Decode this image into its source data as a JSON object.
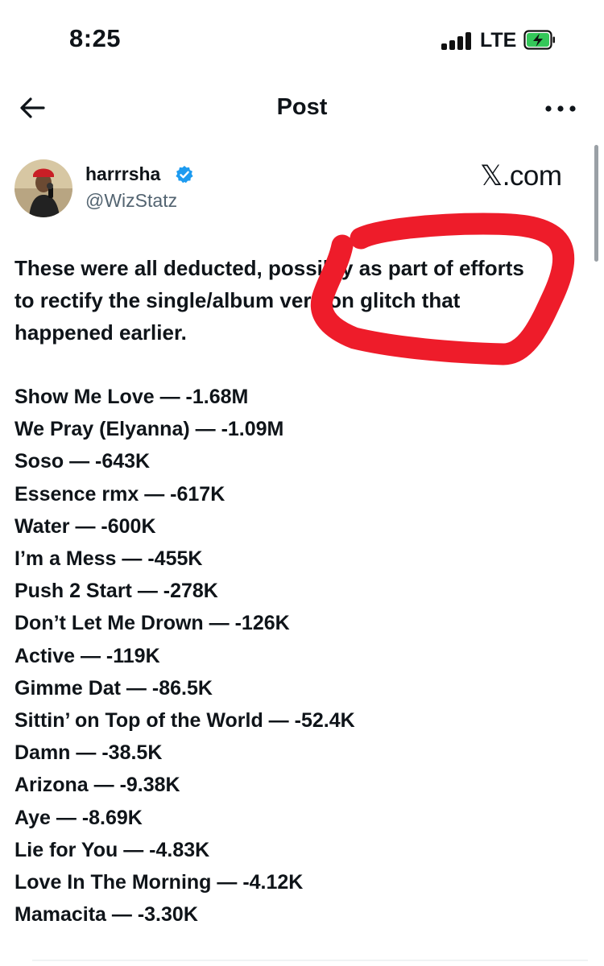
{
  "status_bar": {
    "time": "8:25",
    "carrier": "LTE",
    "battery_state": "charging",
    "signal_bars": 4
  },
  "nav": {
    "title": "Post",
    "back_icon": "arrow-left-icon",
    "more_icon": "ellipsis-icon"
  },
  "post": {
    "author": {
      "display_name": "harrrsha",
      "handle": "@WizStatz",
      "verified": true
    },
    "brand": "𝕏.com",
    "intro_lines": [
      "These were all deducted, possibly as part of efforts",
      "to rectify the single/album version glitch that",
      "happened earlier."
    ],
    "tracks": [
      "Show Me Love — -1.68M",
      "We Pray (Elyanna) — -1.09M",
      "Soso — -643K",
      "Essence rmx — -617K",
      "Water — -600K",
      "I’m a Mess — -455K",
      "Push 2 Start — -278K",
      "Don’t Let Me Drown — -126K",
      "Active — -119K",
      "Gimme Dat — -86.5K",
      "Sittin’ on Top of the World — -52.4K",
      "Damn — -38.5K",
      "Arizona — -9.38K",
      "Aye — -8.69K",
      "Lie for You — -4.83K",
      "Love In The Morning — -4.12K",
      "Mamacita — -3.30K"
    ]
  },
  "colors": {
    "text": "#0f1419",
    "secondary": "#536471",
    "verified": "#1d9bf0",
    "markup": "#ee1c2a",
    "battery_fill": "#34c759"
  }
}
